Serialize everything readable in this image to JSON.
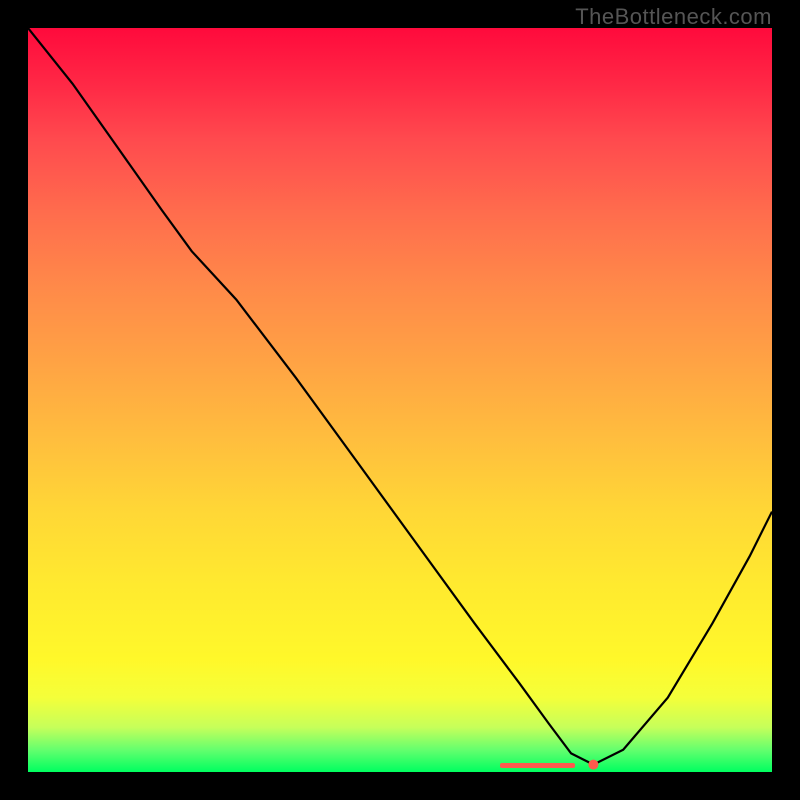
{
  "watermark": "TheBottleneck.com",
  "chart_data": {
    "type": "line",
    "title": "",
    "xlabel": "",
    "ylabel": "",
    "xlim": [
      0,
      1
    ],
    "ylim": [
      0,
      1
    ],
    "notes": "Axes unlabeled. X and Y normalized 0-1 (origin top-left of plot). Curve starts near top-left, descends to a minimum around x≈0.74 (y≈1.0), then rises toward the right edge. Background is a vertical spectral gradient red→green. A short horizontal pink marker segment and a pink dot sit at the curve minimum near the bottom.",
    "series": [
      {
        "name": "curve",
        "x": [
          0.0,
          0.06,
          0.12,
          0.18,
          0.22,
          0.28,
          0.36,
          0.44,
          0.52,
          0.6,
          0.66,
          0.7,
          0.73,
          0.76,
          0.8,
          0.86,
          0.92,
          0.97,
          1.0
        ],
        "y": [
          0.0,
          0.075,
          0.16,
          0.245,
          0.3,
          0.365,
          0.47,
          0.58,
          0.69,
          0.8,
          0.88,
          0.935,
          0.975,
          0.99,
          0.97,
          0.9,
          0.8,
          0.71,
          0.65
        ]
      }
    ],
    "markers": {
      "flat_segment": {
        "x0": 0.635,
        "x1": 0.735,
        "y": 0.99
      },
      "dot": {
        "x": 0.76,
        "y": 0.99,
        "r": 5
      }
    },
    "colors": {
      "curve": "#000000",
      "marker": "#ff5a4d",
      "gradient_top": "#ff0a3c",
      "gradient_bottom": "#00ff60"
    }
  }
}
